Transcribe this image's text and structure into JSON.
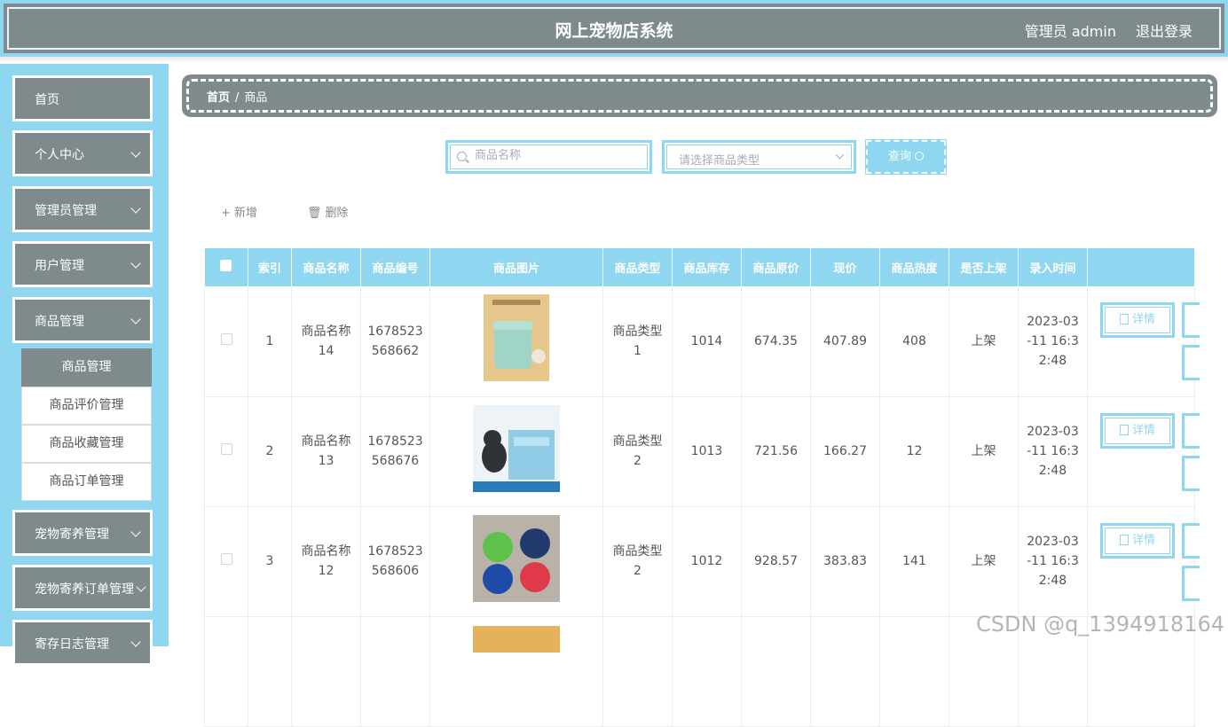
{
  "header": {
    "title": "网上宠物店系统",
    "admin_label": "管理员 admin",
    "logout_label": "退出登录"
  },
  "sidebar": {
    "items": [
      {
        "label": "首页"
      },
      {
        "label": "个人中心"
      },
      {
        "label": "管理员管理"
      },
      {
        "label": "用户管理"
      },
      {
        "label": "商品管理"
      },
      {
        "label": "宠物寄养管理"
      },
      {
        "label": "宠物寄养订单管理"
      },
      {
        "label": "寄存日志管理"
      }
    ],
    "submenu": [
      {
        "label": "商品管理",
        "active": true
      },
      {
        "label": "商品评价管理"
      },
      {
        "label": "商品收藏管理"
      },
      {
        "label": "商品订单管理"
      }
    ]
  },
  "breadcrumb": {
    "home": "首页",
    "sep": "/",
    "current": "商品"
  },
  "search": {
    "name_placeholder": "商品名称",
    "type_placeholder": "请选择商品类型",
    "query_label": "查询"
  },
  "actions": {
    "add_label": "新增",
    "delete_label": "删除"
  },
  "table": {
    "headers": [
      "索引",
      "商品名称",
      "商品编号",
      "商品图片",
      "商品类型",
      "商品库存",
      "商品原价",
      "现价",
      "商品热度",
      "是否上架",
      "录入时间"
    ],
    "rows": [
      {
        "index": "1",
        "name_l1": "商品名称",
        "name_l2": "14",
        "code_l1": "1678523",
        "code_l2": "568662",
        "type_l1": "商品类型",
        "type_l2": "1",
        "stock": "1014",
        "orig": "674.35",
        "price": "407.89",
        "heat": "408",
        "status": "上架",
        "time_l1": "2023-03",
        "time_l2": "-11 16:3",
        "time_l3": "2:48",
        "detail": "详情"
      },
      {
        "index": "2",
        "name_l1": "商品名称",
        "name_l2": "13",
        "code_l1": "1678523",
        "code_l2": "568676",
        "type_l1": "商品类型",
        "type_l2": "2",
        "stock": "1013",
        "orig": "721.56",
        "price": "166.27",
        "heat": "12",
        "status": "上架",
        "time_l1": "2023-03",
        "time_l2": "-11 16:3",
        "time_l3": "2:48",
        "detail": "详情"
      },
      {
        "index": "3",
        "name_l1": "商品名称",
        "name_l2": "12",
        "code_l1": "1678523",
        "code_l2": "568606",
        "type_l1": "商品类型",
        "type_l2": "2",
        "stock": "1012",
        "orig": "928.57",
        "price": "383.83",
        "heat": "141",
        "status": "上架",
        "time_l1": "2023-03",
        "time_l2": "-11 16:3",
        "time_l3": "2:48",
        "detail": "详情"
      }
    ]
  },
  "watermark": "CSDN @q_1394918164",
  "colors": {
    "primary": "#7f8a8d",
    "accent": "#8fd6f0"
  }
}
